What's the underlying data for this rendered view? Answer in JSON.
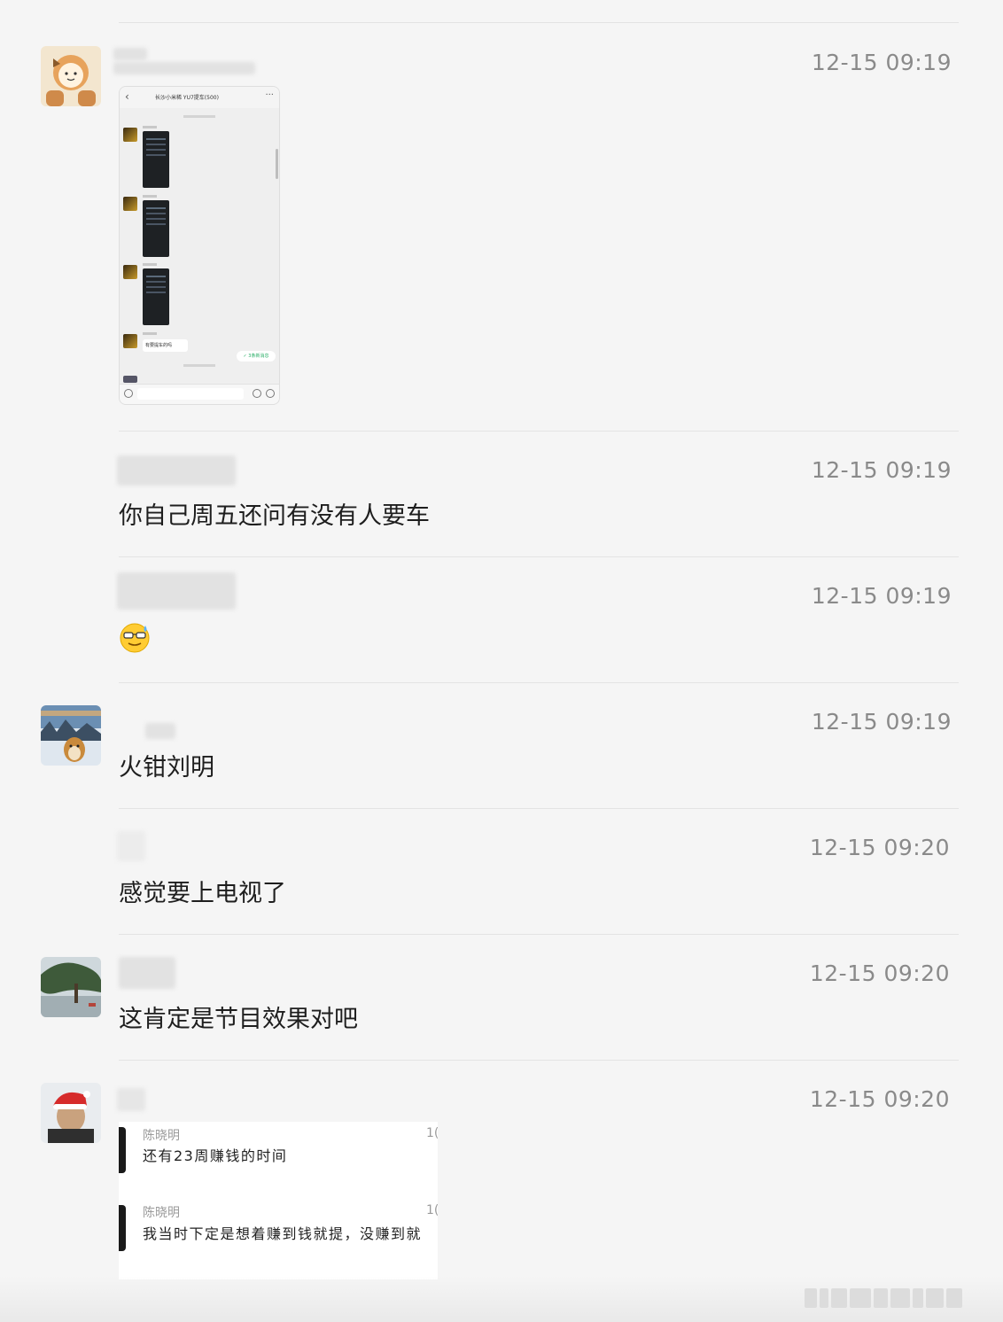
{
  "messages": [
    {
      "id": "m1",
      "time": "12-15 09:19",
      "type": "image",
      "thumbnail": {
        "chat_title": "长沙小米稀 YU7提车(500)",
        "bubble_text": "有要提车的吗",
        "green_pill": "✓ 3条新消息"
      }
    },
    {
      "id": "m2",
      "time": "12-15 09:19",
      "type": "text",
      "text": "你自己周五还问有没有人要车"
    },
    {
      "id": "m3",
      "time": "12-15 09:19",
      "type": "emoji",
      "emoji": "sweat-smile-sunglasses"
    },
    {
      "id": "m4",
      "time": "12-15 09:19",
      "type": "text",
      "text": "火钳刘明"
    },
    {
      "id": "m5",
      "time": "12-15 09:20",
      "type": "text",
      "text": "感觉要上电视了"
    },
    {
      "id": "m6",
      "time": "12-15 09:20",
      "type": "text",
      "text": "这肯定是节目效果对吧"
    },
    {
      "id": "m7",
      "time": "12-15 09:20",
      "type": "quote-image",
      "quotes": [
        {
          "name": "陈晓明",
          "num": "1(",
          "text": "还有23周赚钱的时间"
        },
        {
          "name": "陈晓明",
          "num": "1(",
          "text": "我当时下定是想着赚到钱就提，没赚到就"
        }
      ]
    }
  ],
  "icons": {
    "avatar1": "cartoon-cat-avatar-icon",
    "avatar4": "dog-snow-avatar-icon",
    "avatar6": "tree-landscape-avatar-icon",
    "avatar7": "santa-hat-person-avatar-icon"
  },
  "colors": {
    "background": "#f5f5f5",
    "timestamp": "#8a8a8a",
    "divider": "#e3e3e3",
    "accent_green": "#2aae67"
  }
}
